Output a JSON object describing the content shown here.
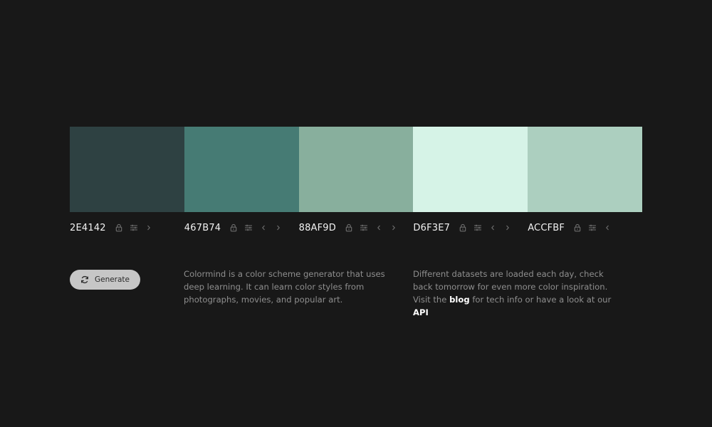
{
  "palette": {
    "swatches": [
      {
        "hex": "2E4142",
        "color": "#2e4142",
        "controls": [
          "lock-icon",
          "adjust-icon",
          "chevron-right-icon"
        ]
      },
      {
        "hex": "467B74",
        "color": "#467b74",
        "controls": [
          "lock-icon",
          "adjust-icon",
          "chevron-left-icon",
          "chevron-right-icon"
        ]
      },
      {
        "hex": "88AF9D",
        "color": "#88af9d",
        "controls": [
          "lock-icon",
          "adjust-icon",
          "chevron-left-icon",
          "chevron-right-icon"
        ]
      },
      {
        "hex": "D6F3E7",
        "color": "#d6f3e7",
        "controls": [
          "lock-icon",
          "adjust-icon",
          "chevron-left-icon",
          "chevron-right-icon"
        ]
      },
      {
        "hex": "ACCFBF",
        "color": "#accfbf",
        "controls": [
          "lock-icon",
          "adjust-icon",
          "chevron-left-icon"
        ]
      }
    ]
  },
  "generate": {
    "label": "Generate",
    "icon": "refresh-icon"
  },
  "description": {
    "about": "Colormind is a color scheme generator that uses deep learning. It can learn color styles from photographs, movies, and popular art.",
    "datasets_prefix": "Different datasets are loaded each day, check back tomorrow for even more color inspiration. Visit the ",
    "blog_link": "blog",
    "datasets_middle": " for tech info or have a look at our ",
    "api_link": "API"
  },
  "colors": {
    "background": "#181818",
    "button": "#c6c6c6",
    "muted_text": "#8e8e8e",
    "icon": "#6f6f6f"
  }
}
